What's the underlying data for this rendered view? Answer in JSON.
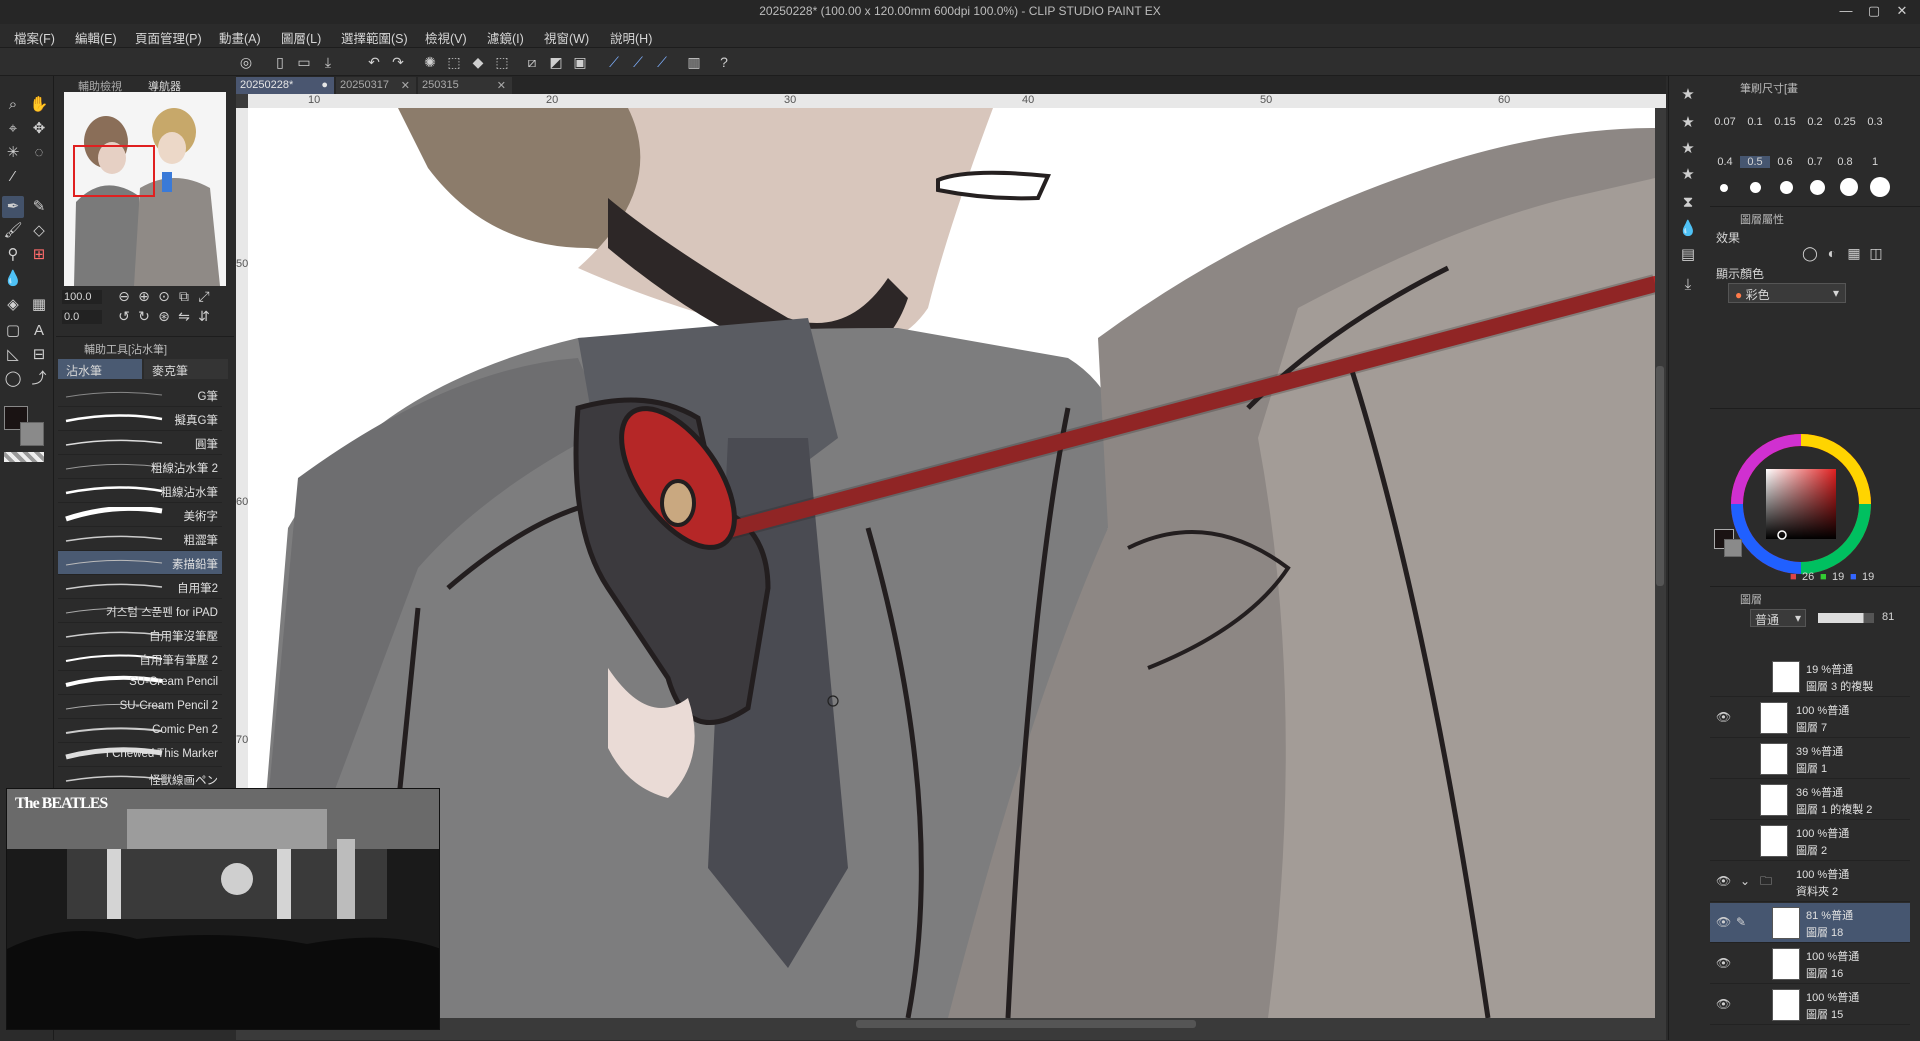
{
  "window": {
    "title": "20250228* (100.00 x 120.00mm 600dpi 100.0%) - CLIP STUDIO PAINT EX"
  },
  "menu": [
    "檔案(F)",
    "編輯(E)",
    "頁面管理(P)",
    "動畫(A)",
    "圖層(L)",
    "選擇範圍(S)",
    "檢視(V)",
    "濾鏡(I)",
    "視窗(W)",
    "說明(H)"
  ],
  "navigator": {
    "tabs": [
      "輔助檢視",
      "導航器"
    ],
    "zoom": "100.0",
    "rotation": "0.0"
  },
  "subtool": {
    "header": "輔助工具[沾水筆]",
    "tabs": [
      "沾水筆",
      "麥克筆"
    ],
    "brushes": [
      "G筆",
      "擬真G筆",
      "圓筆",
      "粗線沾水筆 2",
      "粗線沾水筆",
      "美術字",
      "粗澀筆",
      "素描鉛筆",
      "自用筆2",
      "커스텀 스푼펜 for iPAD",
      "自用筆沒筆壓",
      "自用筆有筆壓 2",
      "SU-Cream Pencil",
      "SU-Cream Pencil 2",
      "Comic Pen 2",
      "I Chewed This Marker",
      "怪獸線画ペン"
    ],
    "selected_index": 7
  },
  "tabs": [
    "20250228*",
    "20250317",
    "250315"
  ],
  "ruler": {
    "h_labels": [
      "10",
      "20",
      "30",
      "40",
      "50",
      "60"
    ],
    "v_labels": [
      "50",
      "60",
      "70"
    ]
  },
  "video": {
    "logo": "The BEATLES"
  },
  "brush_size": {
    "header": "筆刷尺寸[畫",
    "values": [
      "0.07",
      "0.1",
      "0.15",
      "0.2",
      "0.25",
      "0.3",
      "0.4",
      "0.5",
      "0.6",
      "0.7",
      "0.8",
      "1"
    ],
    "selected": "0.5"
  },
  "layer_property": {
    "header": "圖層屬性",
    "effect_label": "效果",
    "display_color_label": "顯示顏色",
    "display_color_value": "彩色"
  },
  "color": {
    "r": "26",
    "g": "19",
    "b": "19",
    "main": "#1a1313",
    "sub": "#8a8a8a"
  },
  "layers": {
    "blend_mode": "普通",
    "opacity": "81",
    "tabs": [
      "圖層",
      "",
      ""
    ],
    "rows": [
      {
        "opacity_mode": "19 %普通",
        "name": "圖層 3 的複製",
        "visible": false,
        "indent": true,
        "selected": false
      },
      {
        "opacity_mode": "100 %普通",
        "name": "圖層 7",
        "visible": true,
        "indent": false,
        "selected": false
      },
      {
        "opacity_mode": "39 %普通",
        "name": "圖層 1",
        "visible": false,
        "indent": false,
        "selected": false
      },
      {
        "opacity_mode": "36 %普通",
        "name": "圖層 1 的複製 2",
        "visible": false,
        "indent": false,
        "selected": false
      },
      {
        "opacity_mode": "100 %普通",
        "name": "圖層 2",
        "visible": false,
        "indent": false,
        "selected": false
      },
      {
        "opacity_mode": "100 %普通",
        "name": "資料夾 2",
        "visible": true,
        "indent": false,
        "selected": false,
        "folder": true
      },
      {
        "opacity_mode": "81 %普通",
        "name": "圖層 18",
        "visible": true,
        "indent": true,
        "selected": true
      },
      {
        "opacity_mode": "100 %普通",
        "name": "圖層 16",
        "visible": true,
        "indent": true,
        "selected": false
      },
      {
        "opacity_mode": "100 %普通",
        "name": "圖層 15",
        "visible": true,
        "indent": true,
        "selected": false
      }
    ]
  }
}
